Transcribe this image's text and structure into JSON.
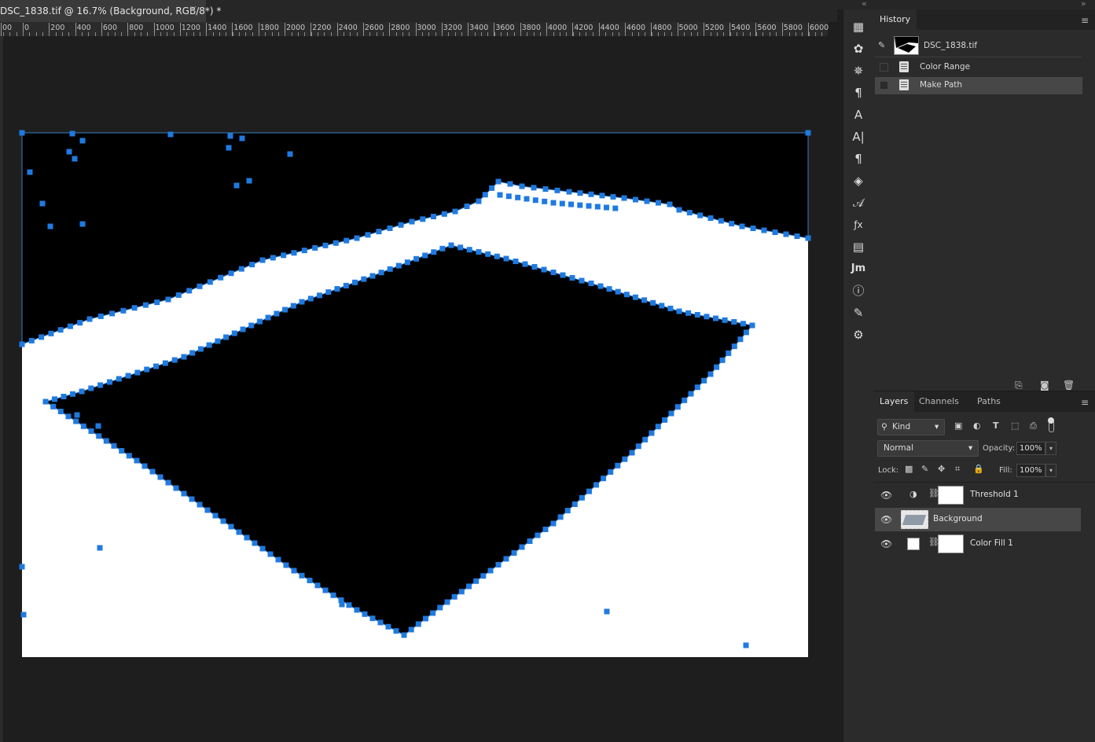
{
  "document": {
    "tab_title": "DSC_1838.tif @ 16.7% (Background, RGB/8*) *",
    "close_glyph": "×"
  },
  "ruler": {
    "labels": [
      "00",
      "0",
      "200",
      "400",
      "600",
      "800",
      "1000",
      "1200",
      "1400",
      "1600",
      "1800",
      "2000",
      "2200",
      "2400",
      "2600",
      "2800",
      "3000",
      "3200",
      "3400",
      "3600",
      "3800",
      "4000",
      "4200",
      "4400",
      "4600",
      "4800",
      "5000",
      "5200",
      "5400",
      "5600",
      "5800",
      "6000"
    ]
  },
  "collapse": {
    "left_glyph": "«",
    "right_glyph": "»"
  },
  "dock": {
    "icons": [
      "grid-icon",
      "palette-icon",
      "ship-wheel-icon",
      "paragraph-style-icon",
      "character-style-icon",
      "character-icon",
      "paragraph-icon",
      "3d-icon",
      "glyphs-icon",
      "fx-icon",
      "notes-icon",
      "measurement-icon",
      "info-icon",
      "brush-icon",
      "adjustments-icon"
    ],
    "jm_label": "Jm"
  },
  "history": {
    "tab_label": "History",
    "menu_glyph": "≡",
    "snapshot_label": "DSC_1838.tif",
    "items": [
      {
        "label": "Color Range",
        "selected": false
      },
      {
        "label": "Make Path",
        "selected": true
      }
    ],
    "footer_icons": [
      "new-document-from-state-icon",
      "camera-icon",
      "trash-icon"
    ]
  },
  "layers_panel": {
    "tabs": [
      {
        "label": "Layers",
        "active": true
      },
      {
        "label": "Channels",
        "active": false
      },
      {
        "label": "Paths",
        "active": false
      }
    ],
    "menu_glyph": "≡",
    "filter": {
      "label": "Kind"
    },
    "blend_mode": "Normal",
    "opacity_label": "Opacity:",
    "opacity_value": "100%",
    "lock_label": "Lock:",
    "fill_label": "Fill:",
    "fill_value": "100%",
    "layers": [
      {
        "name": "Threshold 1",
        "kind": "adjustment",
        "visible": true,
        "selected": false
      },
      {
        "name": "Background",
        "kind": "pixel",
        "visible": true,
        "selected": true
      },
      {
        "name": "Color Fill 1",
        "kind": "fill",
        "visible": true,
        "selected": false
      }
    ]
  },
  "colors": {
    "app_bg": "#1e1e1e",
    "panel_bg": "#2b2b2b",
    "selection_row": "#474747",
    "path_anchor": "#1f7ae0",
    "path_stroke": "#3a7ec2"
  }
}
